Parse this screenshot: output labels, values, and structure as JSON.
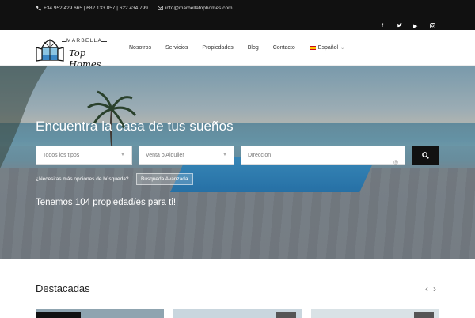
{
  "topbar": {
    "phones": "+34 952 429 665 | 682 133 857 | 622 434 799",
    "email": "info@marbellatophomes.com",
    "social": [
      "facebook-icon",
      "twitter-icon",
      "youtube-icon",
      "instagram-icon"
    ]
  },
  "logo": {
    "line1": "MARBELLA",
    "line2": "Top Homes"
  },
  "nav": {
    "items": [
      "Nosotros",
      "Servicios",
      "Propiedades",
      "Blog",
      "Contacto"
    ],
    "language": "Español"
  },
  "hero": {
    "title": "Encuentra la casa de tus sueños",
    "type_select": "Todos los tipos",
    "mode_select": "Venta o Alquiler",
    "address_placeholder": "Dirección",
    "advanced_prompt": "¿Necesitas más opciones de búsqueda?",
    "advanced_button": "Busqueda Avanzada",
    "count_text": "Tenemos 104 propiedad/es para ti!"
  },
  "featured": {
    "title": "Destacadas"
  },
  "colors": {
    "topbar": "#111111",
    "search_button": "#111111",
    "flag_red": "#c60b1e",
    "flag_yellow": "#ffc400"
  }
}
